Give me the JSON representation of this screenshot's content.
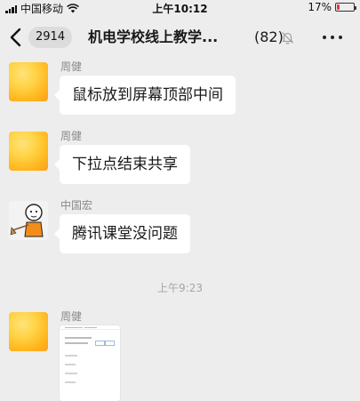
{
  "status_bar": {
    "carrier": "中国移动",
    "time": "上午10:12",
    "battery_percent": "17%",
    "battery_level": 0.17
  },
  "nav": {
    "unread_badge": "2914",
    "title": "机电学校线上教学...",
    "member_count": "(82)"
  },
  "messages": [
    {
      "sender": "周健",
      "text": "鼠标放到屏幕顶部中间"
    },
    {
      "sender": "周健",
      "text": "下拉点结束共享"
    },
    {
      "sender": "中国宏",
      "text": "腾讯课堂没问题"
    }
  ],
  "time_divider": "上午9:23",
  "last_message": {
    "sender": "周健",
    "type": "image"
  }
}
